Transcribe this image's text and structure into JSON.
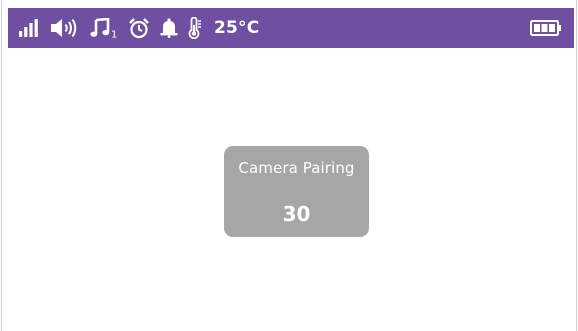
{
  "status_bar": {
    "icons": [
      "signal-strength-icon",
      "speaker-volume-icon",
      "lullaby-music-icon",
      "alarm-clock-icon",
      "bell-alert-icon",
      "thermometer-icon"
    ],
    "lullaby_track": "1",
    "temperature": "25°C",
    "battery_icon": "battery-full-icon",
    "background_color": "#6f4fa2"
  },
  "dialog": {
    "title": "Camera Pairing",
    "countdown": "30",
    "background_color": "#a6a6a6"
  }
}
